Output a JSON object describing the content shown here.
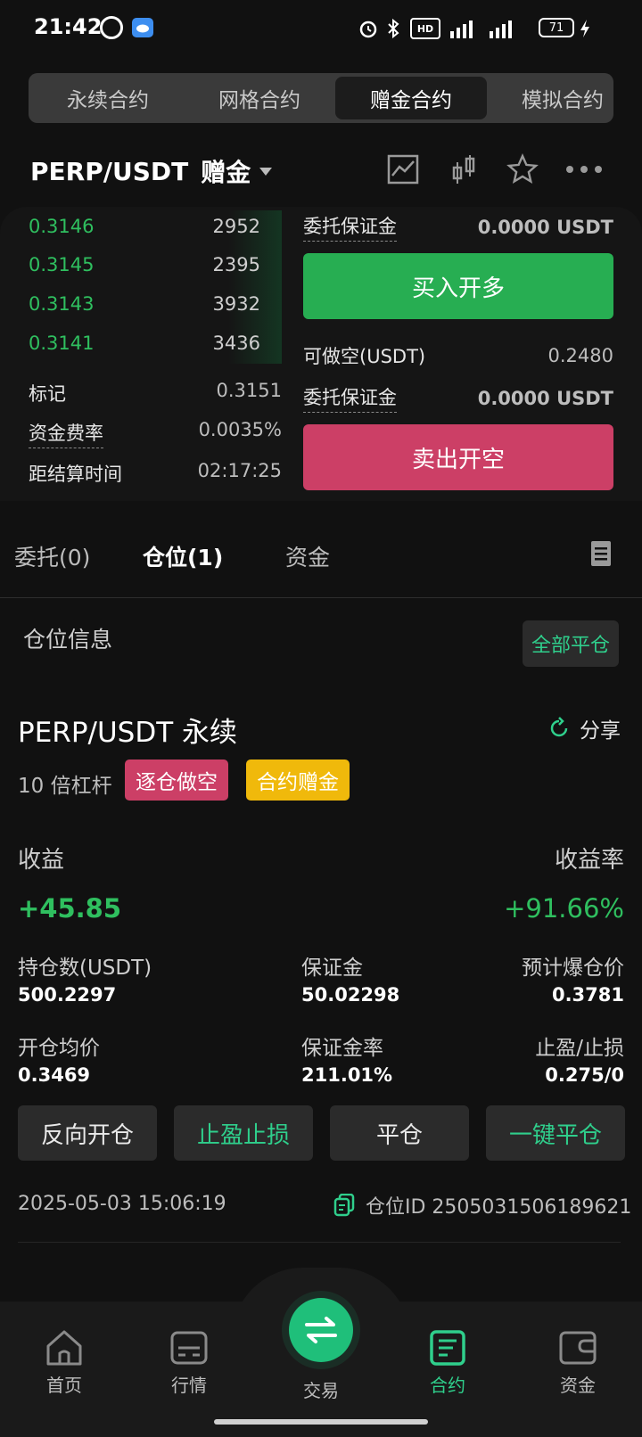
{
  "status": {
    "time": "21:42",
    "battery": "71"
  },
  "top_tabs": [
    {
      "label": "永续合约"
    },
    {
      "label": "网格合约"
    },
    {
      "label": "赠金合约"
    },
    {
      "label": "模拟合约"
    }
  ],
  "pair": {
    "symbol": "PERP/USDT",
    "tag": "赠金"
  },
  "order_book": [
    {
      "price": "0.3146",
      "qty": "2952"
    },
    {
      "price": "0.3145",
      "qty": "2395"
    },
    {
      "price": "0.3143",
      "qty": "3932"
    },
    {
      "price": "0.3141",
      "qty": "3436"
    }
  ],
  "market_info": {
    "mark_label": "标记",
    "mark_value": "0.3151",
    "funding_label": "资金费率",
    "funding_value": "0.0035%",
    "settle_label": "距结算时间",
    "settle_value": "02:17:25"
  },
  "order_form": {
    "margin_label_1": "委托保证金",
    "margin_value_1": "0.0000 USDT",
    "buy_label": "买入开多",
    "short_avail_label": "可做空(USDT)",
    "short_avail_value": "0.2480",
    "margin_label_2": "委托保证金",
    "margin_value_2": "0.0000 USDT",
    "sell_label": "卖出开空"
  },
  "position_tabs": [
    {
      "label": "委托(0)"
    },
    {
      "label": "仓位(1)"
    },
    {
      "label": "资金"
    }
  ],
  "position": {
    "section_title": "仓位信息",
    "close_all": "全部平仓",
    "contract": "PERP/USDT 永续",
    "share": "分享",
    "leverage": "10 倍杠杆",
    "badge_mode": "逐仓做空",
    "badge_bonus": "合约赠金",
    "pnl_label": "收益",
    "pnl_value": "+45.85",
    "roe_label": "收益率",
    "roe_value": "+91.66%",
    "size_label": "持仓数(USDT)",
    "size_value": "500.2297",
    "margin_label": "保证金",
    "margin_value": "50.02298",
    "liq_label": "预计爆仓价",
    "liq_value": "0.3781",
    "entry_label": "开仓均价",
    "entry_value": "0.3469",
    "margin_rate_label": "保证金率",
    "margin_rate_value": "211.01%",
    "tpsl_label": "止盈/止损",
    "tpsl_value": "0.275/0",
    "actions": [
      "反向开仓",
      "止盈止损",
      "平仓",
      "一键平仓"
    ],
    "timestamp": "2025-05-03 15:06:19",
    "position_id": "仓位ID 2505031506189621"
  },
  "bottom_nav": [
    {
      "label": "首页"
    },
    {
      "label": "行情"
    },
    {
      "label": "交易"
    },
    {
      "label": "合约"
    },
    {
      "label": "资金"
    }
  ],
  "colors": {
    "green": "#2fbf5f",
    "accent": "#2fcf8c",
    "red": "#cc3f66",
    "yellow": "#f0b90b"
  }
}
